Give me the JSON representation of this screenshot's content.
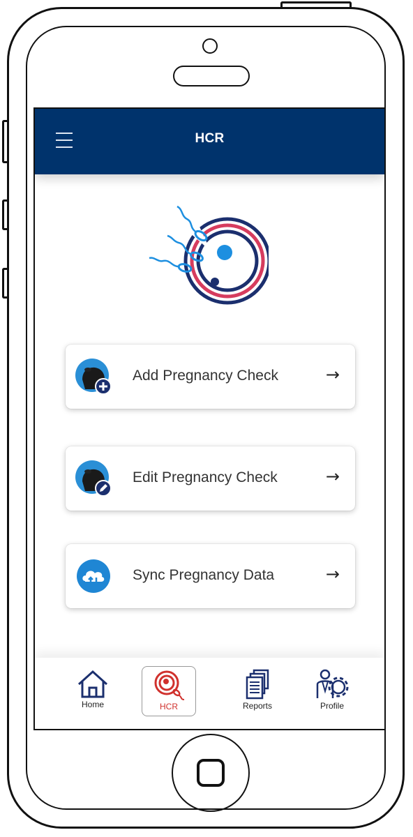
{
  "header": {
    "title": "HCR"
  },
  "actions": [
    {
      "label": "Add Pregnancy Check",
      "icon": "cow-add-icon"
    },
    {
      "label": "Edit Pregnancy Check",
      "icon": "cow-edit-icon"
    },
    {
      "label": "Sync Pregnancy Data",
      "icon": "cloud-sync-icon"
    }
  ],
  "arrow_glyph": "→",
  "bottom_nav": [
    {
      "label": "Home",
      "icon": "home-icon",
      "active": false
    },
    {
      "label": "HCR",
      "icon": "hcr-icon",
      "active": true
    },
    {
      "label": "Reports",
      "icon": "reports-icon",
      "active": false
    },
    {
      "label": "Profile",
      "icon": "profile-settings-icon",
      "active": false
    }
  ],
  "colors": {
    "header": "#00336c",
    "accent_red": "#d0312d",
    "accent_blue": "#1d8fe0",
    "navy": "#1b2f6e"
  }
}
